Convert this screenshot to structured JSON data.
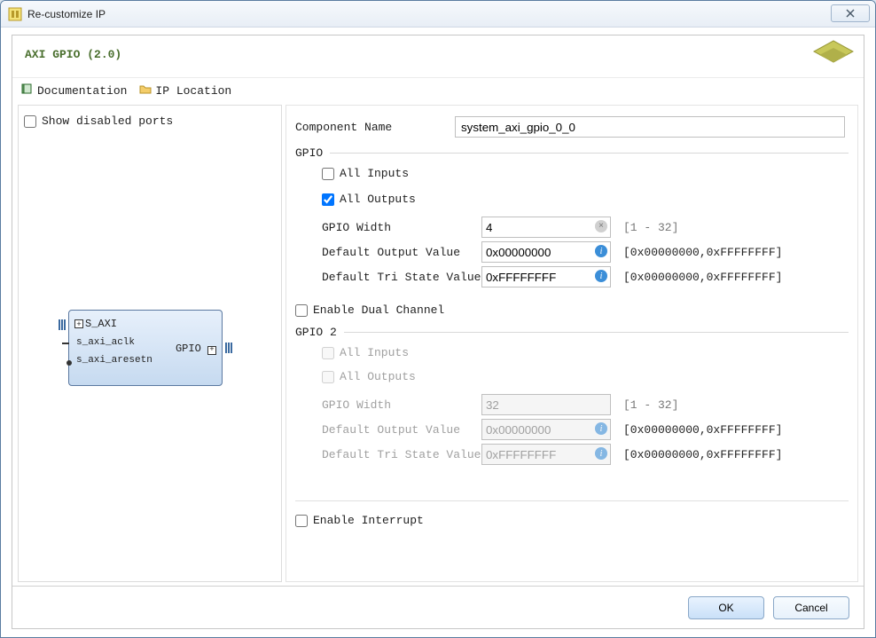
{
  "window": {
    "title": "Re-customize IP",
    "close_label": "X"
  },
  "ip_title": "AXI GPIO (2.0)",
  "toolbar": {
    "documentation": "Documentation",
    "ip_location": "IP Location"
  },
  "left": {
    "show_disabled_ports": "Show disabled ports",
    "block": {
      "s_axi": "S_AXI",
      "s_axi_aclk": "s_axi_aclk",
      "s_axi_aresetn": "s_axi_aresetn",
      "gpio": "GPIO"
    }
  },
  "right": {
    "component_name_label": "Component Name",
    "component_name_value": "system_axi_gpio_0_0",
    "gpio_title": "GPIO",
    "all_inputs": "All Inputs",
    "all_outputs": "All Outputs",
    "gpio_width_label": "GPIO Width",
    "gpio_width_value": "4",
    "gpio_width_range": "[1 - 32]",
    "default_output_label": "Default Output Value",
    "default_output_value": "0x00000000",
    "default_output_range": "[0x00000000,0xFFFFFFFF]",
    "default_tri_label": "Default Tri State Value",
    "default_tri_value": "0xFFFFFFFF",
    "default_tri_range": "[0x00000000,0xFFFFFFFF]",
    "enable_dual": "Enable Dual Channel",
    "gpio2_title": "GPIO 2",
    "gpio2": {
      "all_inputs": "All Inputs",
      "all_outputs": "All Outputs",
      "width_label": "GPIO Width",
      "width_value": "32",
      "width_range": "[1 - 32]",
      "default_output_label": "Default Output Value",
      "default_output_value": "0x00000000",
      "default_output_range": "[0x00000000,0xFFFFFFFF]",
      "default_tri_label": "Default Tri State Value",
      "default_tri_value": "0xFFFFFFFF",
      "default_tri_range": "[0x00000000,0xFFFFFFFF]"
    },
    "enable_interrupt": "Enable Interrupt"
  },
  "footer": {
    "ok": "OK",
    "cancel": "Cancel"
  }
}
